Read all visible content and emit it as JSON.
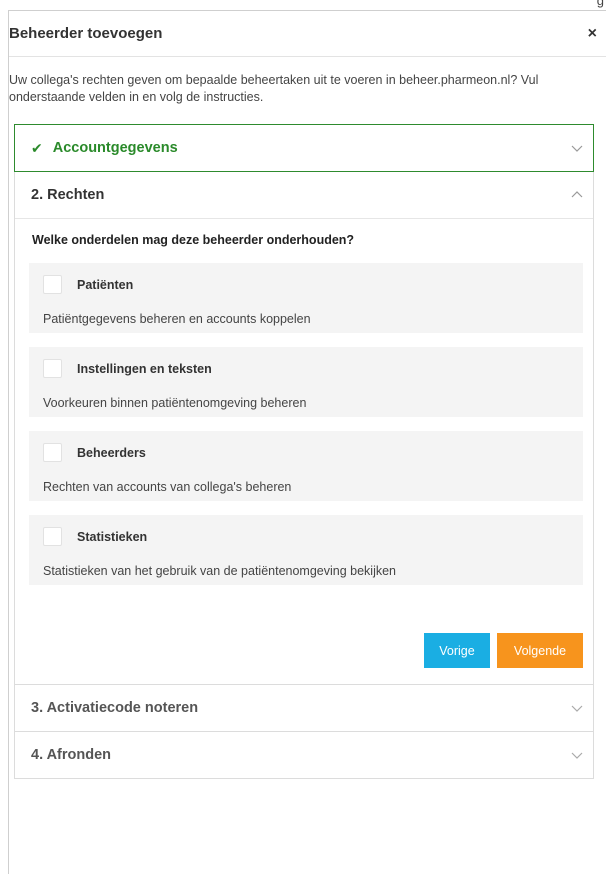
{
  "corner_text": "g",
  "modal": {
    "title": "Beheerder toevoegen",
    "close": "×",
    "intro": "Uw collega's rechten geven om bepaalde beheertaken uit te voeren in beheer.pharmeon.nl? Vul onderstaande velden in en volg de instructies."
  },
  "steps": [
    {
      "label": "Accountgegevens",
      "state": "completed",
      "icon": "check-icon"
    },
    {
      "label": "2. Rechten",
      "state": "open"
    },
    {
      "label": "3. Activatiecode noteren",
      "state": "collapsed"
    },
    {
      "label": "4. Afronden",
      "state": "collapsed"
    }
  ],
  "rechten": {
    "question": "Welke onderdelen mag deze beheerder onderhouden?",
    "options": [
      {
        "label": "Patiënten",
        "description": "Patiëntgegevens beheren en accounts koppelen",
        "checked": false
      },
      {
        "label": "Instellingen en teksten",
        "description": "Voorkeuren binnen patiëntenomgeving beheren",
        "checked": false
      },
      {
        "label": "Beheerders",
        "description": "Rechten van accounts van collega's beheren",
        "checked": false
      },
      {
        "label": "Statistieken",
        "description": "Statistieken van het gebruik van de patiëntenomgeving bekijken",
        "checked": false
      }
    ],
    "prev_label": "Vorige",
    "next_label": "Volgende"
  },
  "colors": {
    "success": "#2a8a2a",
    "prev_button": "#1aaee3",
    "next_button": "#f7941d",
    "option_bg": "#f4f4f4"
  }
}
